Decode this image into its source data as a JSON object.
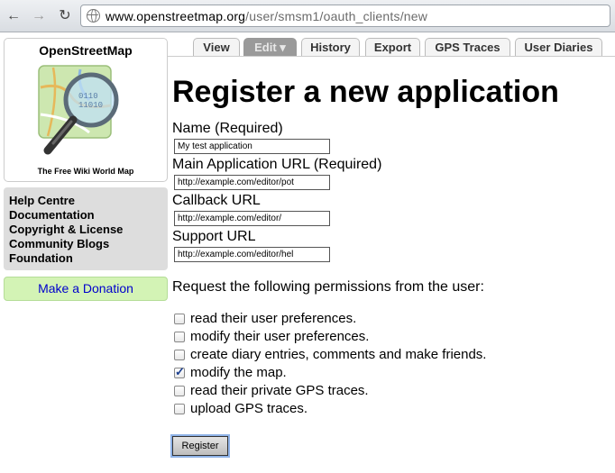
{
  "browser": {
    "url_host": "www.openstreetmap.org",
    "url_path": "/user/smsm1/oauth_clients/new"
  },
  "sidebar": {
    "logo_title": "OpenStreetMap",
    "logo_tagline": "The Free Wiki World Map",
    "help_links": [
      "Help Centre",
      "Documentation",
      "Copyright & License",
      "Community Blogs",
      "Foundation"
    ],
    "donate_label": "Make a Donation"
  },
  "tabs": [
    {
      "label": "View",
      "active": false
    },
    {
      "label": "Edit ▾",
      "active": true
    },
    {
      "label": "History",
      "active": false
    },
    {
      "label": "Export",
      "active": false
    },
    {
      "label": "GPS Traces",
      "active": false
    },
    {
      "label": "User Diaries",
      "active": false
    }
  ],
  "form": {
    "title": "Register a new application",
    "fields": [
      {
        "label": "Name (Required)",
        "value": "My test application"
      },
      {
        "label": "Main Application URL (Required)",
        "value": "http://example.com/editor/pot"
      },
      {
        "label": "Callback URL",
        "value": "http://example.com/editor/"
      },
      {
        "label": "Support URL",
        "value": "http://example.com/editor/hel"
      }
    ],
    "permissions_heading": "Request the following permissions from the user:",
    "permissions": [
      {
        "label": "read their user preferences.",
        "checked": false
      },
      {
        "label": "modify their user preferences.",
        "checked": false
      },
      {
        "label": "create diary entries, comments and make friends.",
        "checked": false
      },
      {
        "label": "modify the map.",
        "checked": true
      },
      {
        "label": "read their private GPS traces.",
        "checked": false
      },
      {
        "label": "upload GPS traces.",
        "checked": false
      }
    ],
    "submit_label": "Register"
  }
}
